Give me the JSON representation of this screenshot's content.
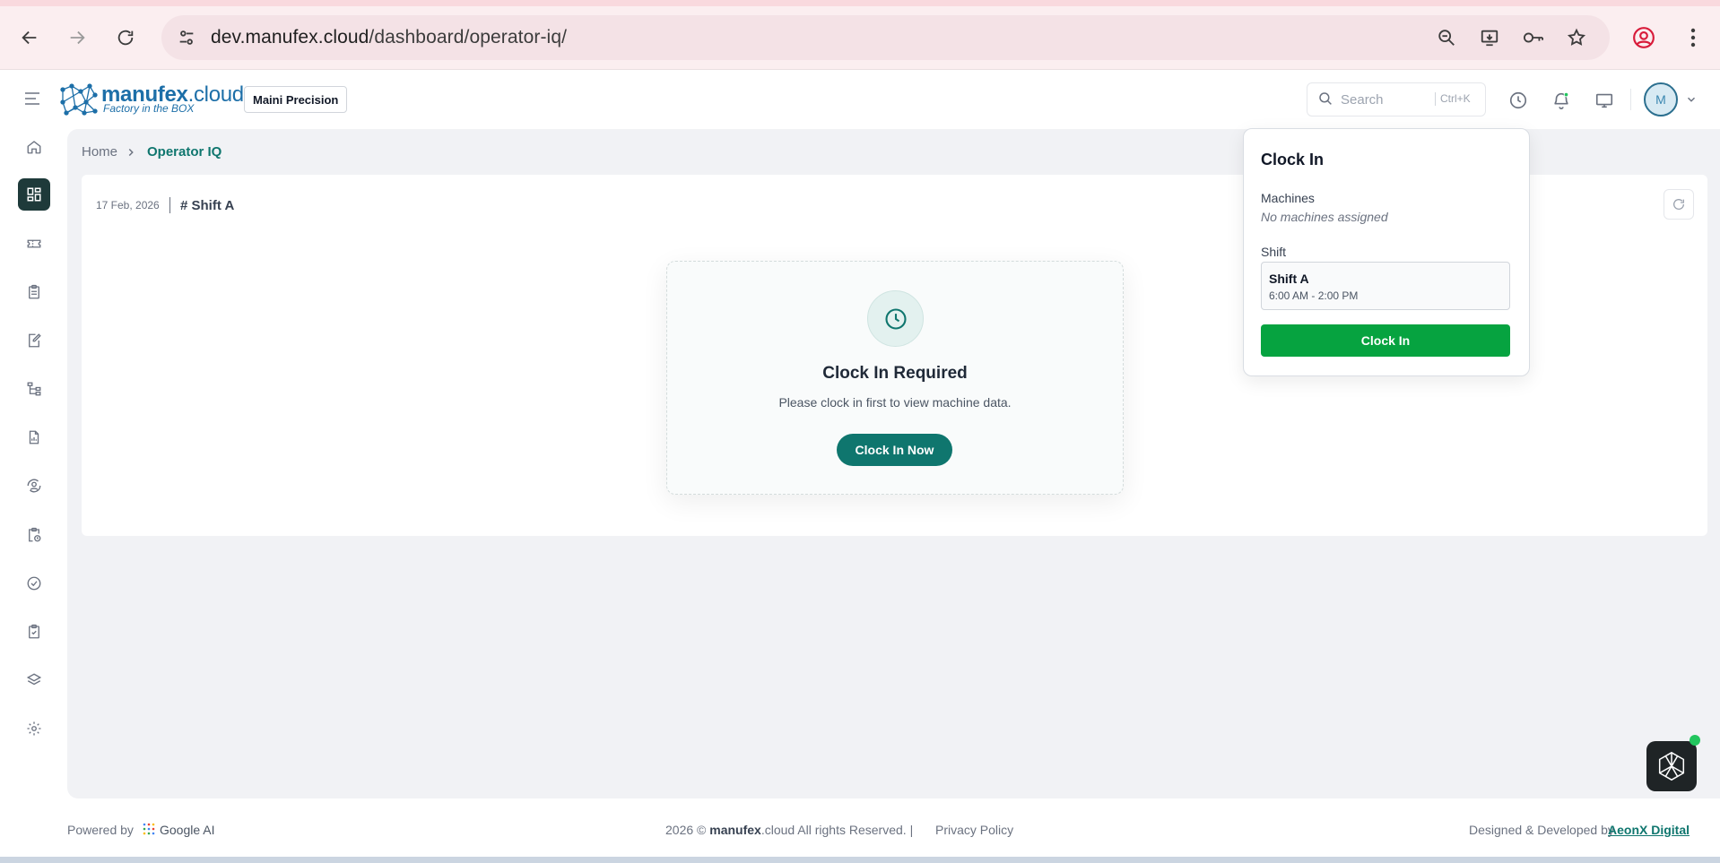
{
  "browser": {
    "url_host": "dev.manufex.cloud",
    "url_path": "/dashboard/operator-iq/"
  },
  "header": {
    "logo_name": "manufex",
    "logo_suffix": ".cloud",
    "logo_tagline": "Factory in the BOX",
    "company": "Maini Precision",
    "search_placeholder": "Search",
    "search_shortcut": "Ctrl+K",
    "avatar_initial": "M"
  },
  "breadcrumb": {
    "home": "Home",
    "separator": "›",
    "current": "Operator IQ"
  },
  "content": {
    "date": "17 Feb, 2026",
    "shift": "# Shift A"
  },
  "clock_required": {
    "title": "Clock In Required",
    "description": "Please clock in first to view machine data.",
    "button": "Clock In Now"
  },
  "dropdown": {
    "title": "Clock In",
    "machines_label": "Machines",
    "machines_value": "No machines assigned",
    "shift_label": "Shift",
    "shift_name": "Shift A",
    "shift_time": "6:00 AM - 2:00 PM",
    "button": "Clock In"
  },
  "footer": {
    "powered_by": "Powered by",
    "google_ai": "Google AI",
    "copyright_prefix": "2026 ©",
    "copyright_brand": "manufex",
    "copyright_suffix": ".cloud All rights Reserved. |",
    "privacy": "Privacy Policy",
    "designed_by": "Designed & Developed by",
    "company_link": "AeonX Digital"
  },
  "colors": {
    "primary": "#0f766e",
    "clockin_green": "#06a340",
    "sidebar_active": "#1e3a3a"
  }
}
